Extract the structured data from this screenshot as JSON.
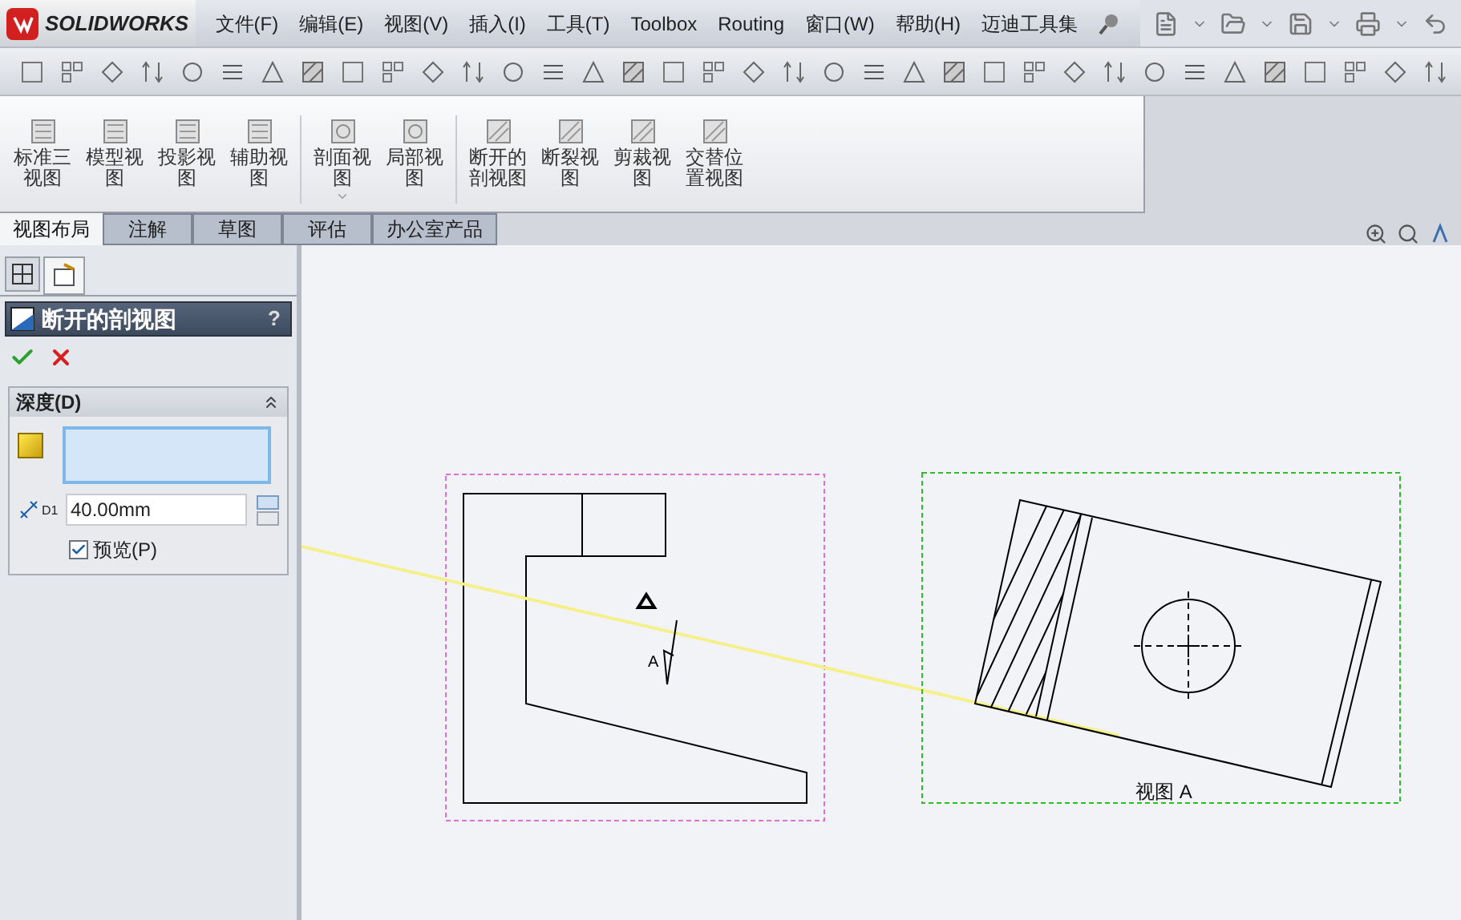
{
  "app": {
    "logo": "SOLIDWORKS"
  },
  "menu": [
    {
      "label": "文件(F)"
    },
    {
      "label": "编辑(E)"
    },
    {
      "label": "视图(V)"
    },
    {
      "label": "插入(I)"
    },
    {
      "label": "工具(T)"
    },
    {
      "label": "Toolbox"
    },
    {
      "label": "Routing"
    },
    {
      "label": "窗口(W)"
    },
    {
      "label": "帮助(H)"
    },
    {
      "label": "迈迪工具集"
    }
  ],
  "command_buttons": [
    {
      "label": "标准三视图",
      "dropdown": false
    },
    {
      "label": "模型视图",
      "dropdown": false
    },
    {
      "label": "投影视图",
      "dropdown": false
    },
    {
      "label": "辅助视图",
      "dropdown": false
    },
    {
      "label": "剖面视图",
      "dropdown": true
    },
    {
      "label": "局部视图",
      "dropdown": false
    },
    {
      "label": "断开的剖视图",
      "dropdown": false
    },
    {
      "label": "断裂视图",
      "dropdown": false
    },
    {
      "label": "剪裁视图",
      "dropdown": false
    },
    {
      "label": "交替位置视图",
      "dropdown": false
    }
  ],
  "tabs": [
    {
      "label": "视图布局",
      "selected": true
    },
    {
      "label": "注解",
      "selected": false
    },
    {
      "label": "草图",
      "selected": false
    },
    {
      "label": "评估",
      "selected": false
    },
    {
      "label": "办公室产品",
      "selected": false
    }
  ],
  "property_manager": {
    "title": "断开的剖视图",
    "help": "?",
    "group": {
      "title": "深度(D)",
      "expanded": true,
      "depth": "40.00mm",
      "dimension_label": "D1",
      "preview": {
        "label": "预览(P)",
        "checked": true
      }
    }
  },
  "drawing": {
    "section_label": "A",
    "view_label": "视图 A"
  }
}
